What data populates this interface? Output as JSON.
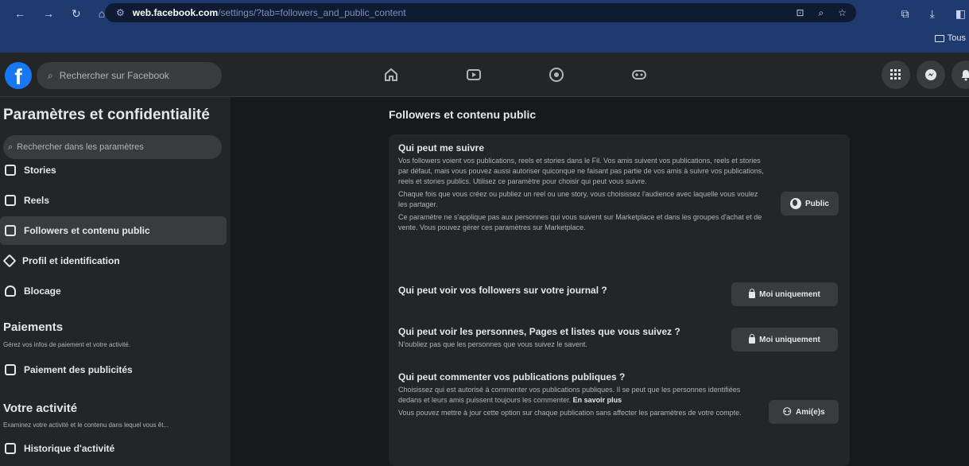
{
  "browser": {
    "url_host": "web.facebook.com",
    "url_path": "/settings/?tab=followers_and_public_content",
    "bookmark_label": "Tous"
  },
  "header": {
    "search_placeholder": "Rechercher sur Facebook",
    "logo_text": "f",
    "nav_icons": [
      "home-icon",
      "video-icon",
      "marketplace-icon",
      "gaming-icon"
    ],
    "right_icons": [
      "menu-grid-icon",
      "messenger-icon",
      "notifications-icon"
    ]
  },
  "sidebar": {
    "title": "Paramètres et confidentialité",
    "search_placeholder": "Rechercher dans les paramètres",
    "items": [
      {
        "label": "Stories",
        "icon": "stories-icon"
      },
      {
        "label": "Reels",
        "icon": "reels-icon"
      },
      {
        "label": "Followers et contenu public",
        "icon": "followers-icon",
        "active": true
      },
      {
        "label": "Profil et identification",
        "icon": "profile-tag-icon"
      },
      {
        "label": "Blocage",
        "icon": "blocking-icon"
      }
    ],
    "payments": {
      "title": "Paiements",
      "subtitle": "Gérez vos infos de paiement et votre activité.",
      "items": [
        {
          "label": "Paiement des publicités",
          "icon": "ads-payment-icon"
        }
      ]
    },
    "activity": {
      "title": "Votre activité",
      "subtitle": "Examinez votre activité et le contenu dans lequel vous êt...",
      "items": [
        {
          "label": "Historique d'activité",
          "icon": "activity-log-icon"
        }
      ]
    }
  },
  "main": {
    "title": "Followers et contenu public",
    "settings": [
      {
        "question": "Qui peut me suivre",
        "desc": [
          "Vos followers voient vos publications, reels et stories dans le Fil. Vos amis suivent vos publications, reels et stories par défaut, mais vous pouvez aussi autoriser quiconque ne faisant pas partie de vos amis à suivre vos publications, reels et stories publics. Utilisez ce paramètre pour choisir qui peut vous suivre.",
          "Chaque fois que vous créez ou publiez un reel ou une story, vous choisissez l'audience avec laquelle vous voulez les partager.",
          "Ce paramètre ne s'applique pas aux personnes qui vous suivent sur Marketplace et dans les groupes d'achat et de vente. Vous pouvez gérer ces paramètres sur Marketplace."
        ],
        "button": "Public"
      },
      {
        "question": "Qui peut voir vos followers sur votre journal ?",
        "button": "Moi uniquement"
      },
      {
        "question": "Qui peut voir les personnes, Pages et listes que vous suivez ?",
        "desc": [
          "N'oubliez pas que les personnes que vous suivez le savent."
        ],
        "button": "Moi uniquement"
      },
      {
        "question": "Qui peut commenter vos publications publiques ?",
        "desc_main": "Choisissez qui est autorisé à commenter vos publications publiques. Il se peut que les personnes identifiées dedans et leurs amis puissent toujours les commenter.",
        "learn_more": "En savoir plus",
        "desc_extra": "Vous pouvez mettre à jour cette option sur chaque publication sans affecter les paramètres de votre compte.",
        "button": "Ami(e)s"
      }
    ]
  }
}
